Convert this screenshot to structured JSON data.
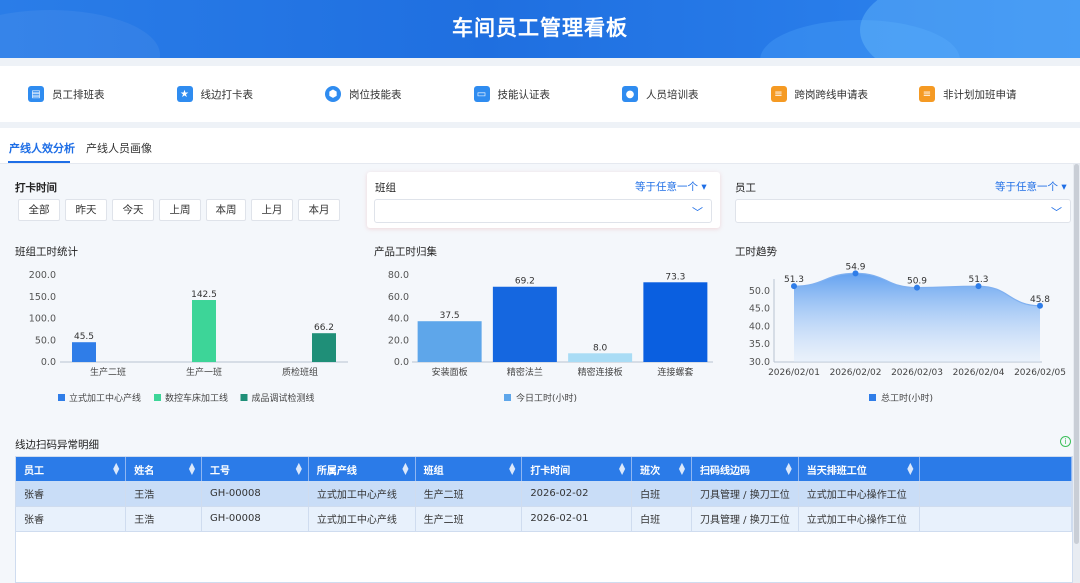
{
  "header": {
    "title": "车间员工管理看板"
  },
  "quick_links": [
    {
      "label": "员工排班表",
      "icon": "calendar-icon",
      "color": "#2f8cf0"
    },
    {
      "label": "线边打卡表",
      "icon": "bookmark-star-icon",
      "color": "#2f8cf0"
    },
    {
      "label": "岗位技能表",
      "icon": "hexagon-icon",
      "color": "#2f8cf0"
    },
    {
      "label": "技能认证表",
      "icon": "certificate-icon",
      "color": "#2f8cf0"
    },
    {
      "label": "人员培训表",
      "icon": "user-icon",
      "color": "#2f8cf0"
    },
    {
      "label": "跨岗跨线申请表",
      "icon": "form-icon",
      "color": "#f59a23"
    },
    {
      "label": "非计划加班申请",
      "icon": "form-icon",
      "color": "#f59a23"
    }
  ],
  "tabs": [
    {
      "label": "产线人效分析",
      "active": true
    },
    {
      "label": "产线人员画像",
      "active": false
    }
  ],
  "filters": {
    "time": {
      "title": "打卡时间",
      "buttons": [
        "全部",
        "昨天",
        "今天",
        "上周",
        "本周",
        "上月",
        "本月"
      ]
    },
    "team": {
      "title": "班组",
      "mode": "等于任意一个",
      "value": ""
    },
    "employee": {
      "title": "员工",
      "mode": "等于任意一个",
      "value": ""
    }
  },
  "accent_color": "#1e6ee6",
  "chart_data": [
    {
      "type": "bar",
      "title": "班组工时统计",
      "categories": [
        "生产二班",
        "生产一班",
        "质检班组"
      ],
      "series": [
        {
          "name": "立式加工中心产线",
          "color": "#2f7de8",
          "values": [
            45.5,
            null,
            null
          ]
        },
        {
          "name": "数控车床加工线",
          "color": "#3dd598",
          "values": [
            null,
            142.5,
            null
          ]
        },
        {
          "name": "成品调试检测线",
          "color": "#1f8f78",
          "values": [
            null,
            null,
            66.2
          ]
        }
      ],
      "ylim": [
        0,
        200
      ],
      "yticks": [
        "200.0",
        "150.0",
        "100.0",
        "50.0",
        "0.0"
      ],
      "legend": "bottom",
      "grid": false
    },
    {
      "type": "bar",
      "title": "产品工时归集",
      "categories": [
        "安装面板",
        "精密法兰",
        "精密连接板",
        "连接螺套"
      ],
      "series": [
        {
          "name": "今日工时(小时)",
          "color": "#5ea6ea",
          "values": [
            37.5,
            69.2,
            8.0,
            73.3
          ]
        }
      ],
      "bar_colors": [
        "#5ea6ea",
        "#1567e0",
        "#a9dcf5",
        "#0a5fe0"
      ],
      "ylim": [
        0,
        80
      ],
      "yticks": [
        "80.0",
        "60.0",
        "40.0",
        "20.0",
        "0.0"
      ],
      "legend": "bottom",
      "grid": false
    },
    {
      "type": "area",
      "title": "工时趋势",
      "x": [
        "2026/02/01",
        "2026/02/02",
        "2026/02/03",
        "2026/02/04",
        "2026/02/05"
      ],
      "series": [
        {
          "name": "总工时(小时)",
          "color": "#2f7de8",
          "values": [
            51.3,
            54.9,
            50.9,
            51.3,
            45.8
          ]
        }
      ],
      "ylim": [
        30,
        55
      ],
      "yticks": [
        "50.0",
        "45.0",
        "40.0",
        "35.0",
        "30.0"
      ],
      "legend": "bottom",
      "grid": false
    }
  ],
  "table": {
    "title": "线边扫码异常明细",
    "columns": [
      "员工",
      "姓名",
      "工号",
      "所属产线",
      "班组",
      "打卡时间",
      "班次",
      "扫码线边码",
      "当天排班工位"
    ],
    "rows": [
      [
        "张睿",
        "王浩",
        "GH-00008",
        "立式加工中心产线",
        "生产二班",
        "2026-02-02",
        "白班",
        "刀具管理 / 换刀工位",
        "立式加工中心操作工位"
      ],
      [
        "张睿",
        "王浩",
        "GH-00008",
        "立式加工中心产线",
        "生产二班",
        "2026-02-01",
        "白班",
        "刀具管理 / 换刀工位",
        "立式加工中心操作工位"
      ]
    ]
  }
}
